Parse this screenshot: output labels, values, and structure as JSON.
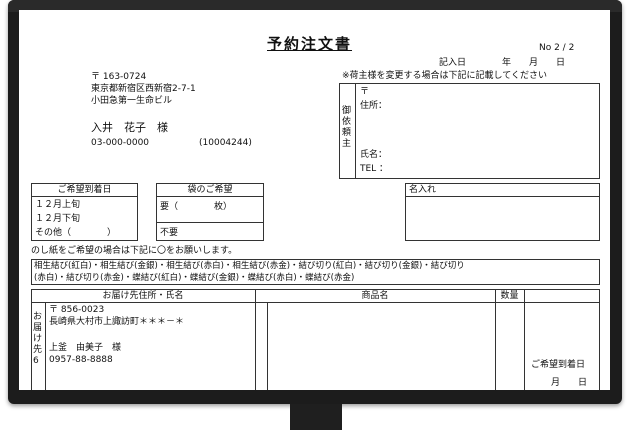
{
  "form": {
    "title": "予約注文書",
    "page_no": "No  2 / 2",
    "entry_date": "記入日　　　　年　　月　　日",
    "recipient_note": "※荷主様を変更する場合は下記に記載してください",
    "customer": {
      "postal": "〒 163-0724",
      "address1": "東京都新宿区西新宿2-7-1",
      "address2": "小田急第一生命ビル",
      "name": "入井　花子　様",
      "phone": "03-000-0000",
      "customer_id": "(10004244)"
    },
    "requester": {
      "label": "御依頼主",
      "postal_mark": "〒",
      "address_label": "住所：",
      "name_label": "氏名：",
      "tel_label": "TEL ："
    },
    "delivery_date": {
      "header": "ご希望到着日",
      "options": [
        "１２月上旬",
        "１２月下旬",
        "その他（　　　　）"
      ]
    },
    "bag": {
      "header": "袋のご希望",
      "option1": "要（　　　　枚）",
      "option2": "不要"
    },
    "engraving": {
      "header": "名入れ"
    },
    "noshi": {
      "note": "のし紙をご希望の場合は下記に〇をお願いします。",
      "line1": "相生結び(紅白)・相生結び(金銀)・相生結び(赤白)・相生結び(赤金)・結び切り(紅白)・結び切り(金銀)・結び切り",
      "line2": "(赤白)・結び切り(赤金)・蝶結び(紅白)・蝶結び(金銀)・蝶結び(赤白)・蝶結び(赤金)"
    },
    "table": {
      "col_address": "お届け先住所・氏名",
      "col_product": "商品名",
      "col_qty": "数量",
      "row_label": "お届け先6",
      "row": {
        "postal": "〒 856-0023",
        "address": "長崎県大村市上諏訪町＊＊＊－＊",
        "name": "上釜　由美子　様",
        "phone": "0957-88-8888"
      },
      "arrival_label": "ご希望到着日",
      "arrival_value": "月　　日"
    }
  }
}
